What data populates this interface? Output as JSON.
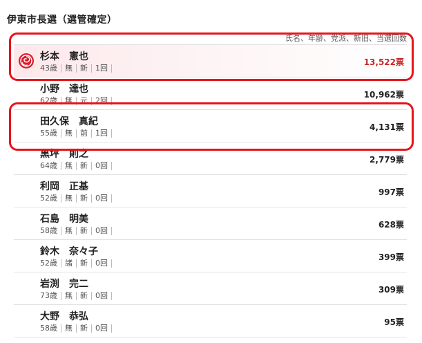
{
  "title": "伊東市長選（選管確定）",
  "legend": "氏名、年齢、党派、新旧、当選回数",
  "colors": {
    "winner_vote": "#c62828",
    "highlight_border": "#e5141b",
    "rose": "#d81e2b"
  },
  "candidates": [
    {
      "name": "杉本　憲也",
      "age": "43歳",
      "party": "無",
      "status": "新",
      "terms": "1回",
      "votes": "13,522票",
      "elected": true,
      "icon": "rose-icon"
    },
    {
      "name": "小野　達也",
      "age": "62歳",
      "party": "無",
      "status": "元",
      "terms": "2回",
      "votes": "10,962票"
    },
    {
      "name": "田久保　真紀",
      "age": "55歳",
      "party": "無",
      "status": "前",
      "terms": "1回",
      "votes": "4,131票"
    },
    {
      "name": "黒坪　則之",
      "age": "64歳",
      "party": "無",
      "status": "新",
      "terms": "0回",
      "votes": "2,779票"
    },
    {
      "name": "利岡　正基",
      "age": "52歳",
      "party": "無",
      "status": "新",
      "terms": "0回",
      "votes": "997票"
    },
    {
      "name": "石島　明美",
      "age": "58歳",
      "party": "無",
      "status": "新",
      "terms": "0回",
      "votes": "628票"
    },
    {
      "name": "鈴木　奈々子",
      "age": "52歳",
      "party": "諸",
      "status": "新",
      "terms": "0回",
      "votes": "399票"
    },
    {
      "name": "岩渕　完二",
      "age": "73歳",
      "party": "無",
      "status": "新",
      "terms": "0回",
      "votes": "309票"
    },
    {
      "name": "大野　恭弘",
      "age": "58歳",
      "party": "無",
      "status": "新",
      "terms": "0回",
      "votes": "95票"
    }
  ]
}
